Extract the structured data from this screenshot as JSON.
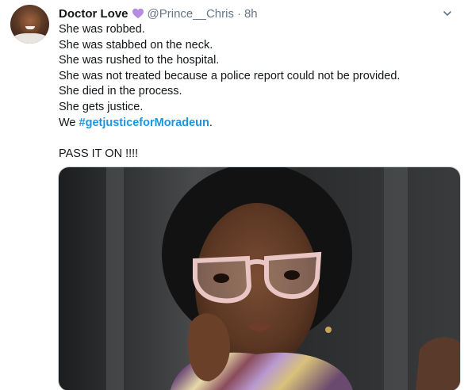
{
  "author": {
    "display_name": "Doctor Love",
    "badge_icon": "purple-heart-icon",
    "handle": "@Prince__Chris",
    "separator": "·",
    "time": "8h"
  },
  "tweet": {
    "lines": [
      "She was robbed.",
      "She was stabbed on the neck.",
      "She was rushed to the hospital.",
      "She was not treated because a police report could not be provided.",
      "She died in the process.",
      "She gets justice."
    ],
    "last_line_prefix": "We ",
    "hashtag": "#getjusticeforMoradeun",
    "last_line_suffix": ".",
    "closing": "PASS IT ON !!!!"
  },
  "colors": {
    "hashtag": "#1b95e0",
    "secondary_text": "#657786",
    "primary_text": "#14171a",
    "badge": "#b58de0"
  }
}
